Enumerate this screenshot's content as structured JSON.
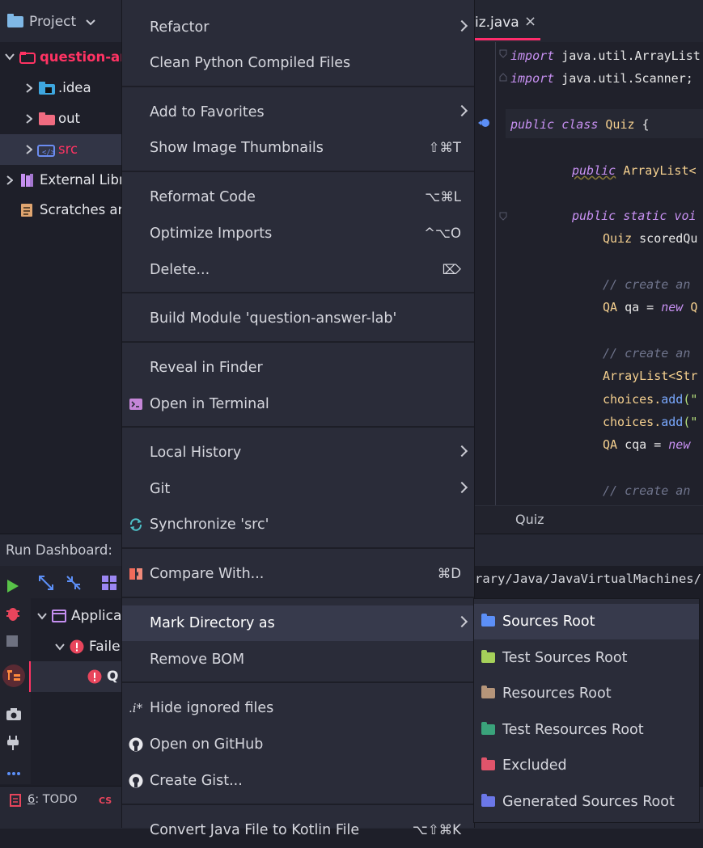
{
  "project_panel": {
    "title": "Project",
    "tree": [
      {
        "label": "question-ar",
        "kind": "root"
      },
      {
        "label": ".idea"
      },
      {
        "label": "out"
      },
      {
        "label": "src"
      },
      {
        "label": "External Libr"
      },
      {
        "label": "Scratches ar"
      }
    ]
  },
  "editor": {
    "tab_label": "iz.java",
    "close_glyph": "×",
    "breadcrumb": "Quiz",
    "code": {
      "l1_kw": "import",
      "l1_rest": " java.util.ArrayList",
      "l2_kw": "import",
      "l2_rest": " java.util.Scanner;",
      "l3_kw1": "public",
      "l3_kw2": " class",
      "l3_name": " Quiz",
      "l3_brace": " {",
      "l4_kw": "public",
      "l4_type": " ArrayList<",
      "l5_kw": "public static voi",
      "l6_type": "Quiz",
      "l6_rest": " scoredQu",
      "l7_cm": "// create an",
      "l8_type": "QA",
      "l8_rest": " qa = ",
      "l8_kw": "new",
      "l8_end": " Q",
      "l9_cm": "// create an",
      "l10_type": "ArrayList<Str",
      "l11_a": "choices.",
      "l11_fn": "add",
      "l11_b": "(\"",
      "l12_a": "choices.",
      "l12_fn": "add",
      "l12_b": "(\"",
      "l13_type": "QA",
      "l13_rest": " cqa = ",
      "l13_kw": "new",
      "l14_cm": "// create an"
    }
  },
  "run_dashboard": {
    "title": "Run Dashboard:",
    "tree": [
      {
        "label": "Applica"
      },
      {
        "label": "Faile"
      },
      {
        "label": "Q"
      }
    ],
    "console_lines": [
      "rary/Java/JavaVirtualMachines/"
    ]
  },
  "bottom_bar": {
    "todo": "6: TODO",
    "todo_num": "6",
    "todo_label": ": TODO"
  },
  "context_menu": {
    "items": [
      {
        "label": "Refactor",
        "submenu": true
      },
      {
        "label": "Clean Python Compiled Files"
      },
      {
        "label": "Add to Favorites",
        "submenu": true
      },
      {
        "label": "Show Image Thumbnails",
        "shortcut": "⇧⌘T"
      },
      {
        "label": "Reformat Code",
        "shortcut": "⌥⌘L"
      },
      {
        "label": "Optimize Imports",
        "shortcut": "^⌥O"
      },
      {
        "label": "Delete...",
        "shortcut": "⌦"
      },
      {
        "label": "Build Module 'question-answer-lab'"
      },
      {
        "label": "Reveal in Finder"
      },
      {
        "label": "Open in Terminal"
      },
      {
        "label": "Local History",
        "submenu": true
      },
      {
        "label": "Git",
        "submenu": true
      },
      {
        "label": "Synchronize 'src'"
      },
      {
        "label": "Compare With...",
        "shortcut": "⌘D"
      },
      {
        "label": "Mark Directory as",
        "submenu": true,
        "highlighted": true
      },
      {
        "label": "Remove BOM"
      },
      {
        "label": "Hide ignored files"
      },
      {
        "label": "Open on GitHub"
      },
      {
        "label": "Create Gist..."
      },
      {
        "label": "Convert Java File to Kotlin File",
        "shortcut": "⌥⇧⌘K"
      }
    ]
  },
  "mark_directory_submenu": {
    "items": [
      {
        "label": "Sources Root",
        "color": "#5c8ff7",
        "highlighted": true
      },
      {
        "label": "Test Sources Root",
        "color": "#a6d15a"
      },
      {
        "label": "Resources Root",
        "color": "#b5957a"
      },
      {
        "label": "Test Resources Root",
        "color": "#3aa37b"
      },
      {
        "label": "Excluded",
        "color": "#e0546b"
      },
      {
        "label": "Generated Sources Root",
        "color": "#6b77e8"
      }
    ]
  },
  "colors": {
    "accent_red": "#ff3363",
    "highlight": "#373a4c",
    "menu_bg": "#2a2c39"
  }
}
